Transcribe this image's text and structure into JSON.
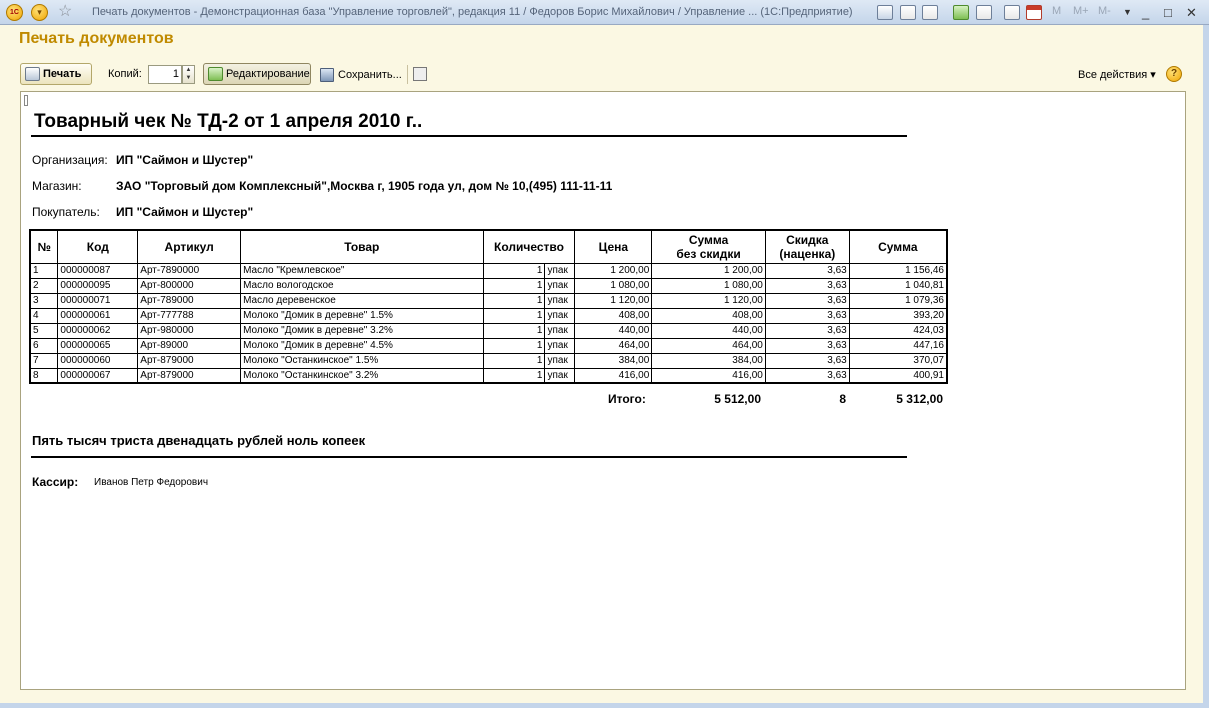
{
  "window": {
    "logo_text": "1C",
    "title": "Печать документов - Демонстрационная база \"Управление торговлей\", редакция 11 / Федоров Борис Михайлович / Управление ... (1С:Предприятие)",
    "menu_m1": "M",
    "menu_m2": "M+",
    "menu_m3": "M-"
  },
  "form": {
    "title": "Печать документов"
  },
  "toolbar": {
    "print_label": "Печать",
    "copies_label": "Копий:",
    "copies_value": "1",
    "edit_label": "Редактирование",
    "save_label": "Сохранить...",
    "all_actions_label": "Все действия ▾",
    "help_label": "?"
  },
  "document": {
    "title": "Товарный чек № ТД-2 от 1 апреля 2010 г..",
    "org_label": "Организация:",
    "org_value": "ИП \"Саймон и Шустер\"",
    "shop_label": "Магазин:",
    "shop_value": "ЗАО \"Торговый дом Комплексный\",Москва г, 1905 года ул, дом № 10,(495) 111-11-11",
    "buyer_label": "Покупатель:",
    "buyer_value": "ИП \"Саймон и Шустер\"",
    "columns": [
      "№",
      "Код",
      "Артикул",
      "Товар",
      "Количество",
      "Цена",
      "Сумма\nбез скидки",
      "Скидка\n(наценка)",
      "Сумма"
    ],
    "rows": [
      [
        "1",
        "000000087",
        "Арт-7890000",
        "Масло \"Кремлевское\"",
        "1",
        "упак",
        "1 200,00",
        "1 200,00",
        "3,63",
        "1 156,46"
      ],
      [
        "2",
        "000000095",
        "Арт-800000",
        "Масло вологодское",
        "1",
        "упак",
        "1 080,00",
        "1 080,00",
        "3,63",
        "1 040,81"
      ],
      [
        "3",
        "000000071",
        "Арт-789000",
        "Масло деревенское",
        "1",
        "упак",
        "1 120,00",
        "1 120,00",
        "3,63",
        "1 079,36"
      ],
      [
        "4",
        "000000061",
        "Арт-777788",
        "Молоко \"Домик в деревне\" 1.5%",
        "1",
        "упак",
        "408,00",
        "408,00",
        "3,63",
        "393,20"
      ],
      [
        "5",
        "000000062",
        "Арт-980000",
        "Молоко \"Домик в деревне\" 3.2%",
        "1",
        "упак",
        "440,00",
        "440,00",
        "3,63",
        "424,03"
      ],
      [
        "6",
        "000000065",
        "Арт-89000",
        "Молоко \"Домик в деревне\" 4.5%",
        "1",
        "упак",
        "464,00",
        "464,00",
        "3,63",
        "447,16"
      ],
      [
        "7",
        "000000060",
        "Арт-879000",
        "Молоко \"Останкинское\" 1.5%",
        "1",
        "упак",
        "384,00",
        "384,00",
        "3,63",
        "370,07"
      ],
      [
        "8",
        "000000067",
        "Арт-879000",
        "Молоко \"Останкинское\" 3.2%",
        "1",
        "упак",
        "416,00",
        "416,00",
        "3,63",
        "400,91"
      ]
    ],
    "totals_label": "Итого:",
    "total_without_discount": "5 512,00",
    "total_discount": "8",
    "total_sum": "5 312,00",
    "amount_in_words": "Пять тысяч триста двенадцать рублей ноль копеек",
    "cashier_label": "Кассир:",
    "cashier_name": "Иванов Петр Федорович"
  }
}
